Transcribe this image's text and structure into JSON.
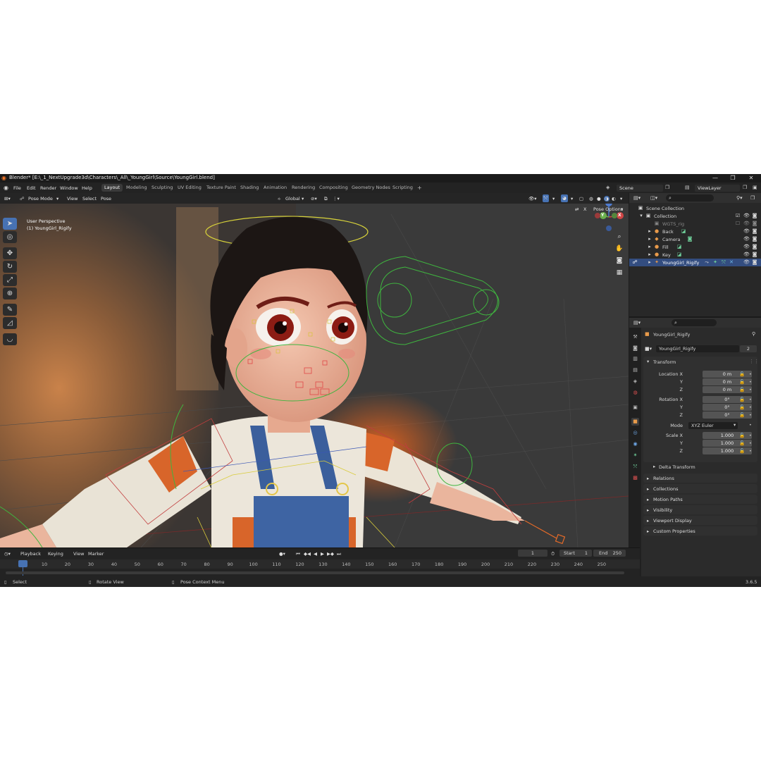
{
  "window": {
    "title": "Blender* [E:\\_1_NextUpgrade3d\\Characters\\_All\\_YoungGirl\\Source\\YoungGirl.blend]",
    "controls": [
      "—",
      "❐",
      "✕"
    ]
  },
  "menubar": {
    "menus": [
      "File",
      "Edit",
      "Render",
      "Window",
      "Help"
    ],
    "workspaces": [
      "Layout",
      "Modeling",
      "Sculpting",
      "UV Editing",
      "Texture Paint",
      "Shading",
      "Animation",
      "Rendering",
      "Compositing",
      "Geometry Nodes",
      "Scripting"
    ],
    "add_workspace": "+",
    "scene": "Scene",
    "view_layer": "ViewLayer"
  },
  "viewport": {
    "mode": "Pose Mode",
    "menus": [
      "View",
      "Select",
      "Pose"
    ],
    "transform_orientation": "Global",
    "pose_options": "Pose Options",
    "overlay_text_1": "User Perspective",
    "overlay_text_2": "(1) YoungGirl_Rigify",
    "gizmo_axes": {
      "z": "Z",
      "y": "Y",
      "x": "X"
    }
  },
  "timeline": {
    "menus": [
      "Playback",
      "Keying",
      "View",
      "Marker"
    ],
    "current_frame": "1",
    "start_label": "Start",
    "start_value": "1",
    "end_label": "End",
    "end_value": "250",
    "ticks": [
      "1",
      "10",
      "20",
      "30",
      "40",
      "50",
      "60",
      "70",
      "80",
      "90",
      "100",
      "110",
      "120",
      "130",
      "140",
      "150",
      "160",
      "170",
      "180",
      "190",
      "200",
      "210",
      "220",
      "230",
      "240",
      "250"
    ]
  },
  "statusbar": {
    "items": [
      "Select",
      "Rotate View",
      "Pose Context Menu"
    ],
    "version": "3.6.5"
  },
  "outliner": {
    "root": "Scene Collection",
    "collection": "Collection",
    "items": [
      "WGTS_rig",
      "Back",
      "Camera",
      "Fill",
      "Key",
      "YoungGirl_Rigify"
    ]
  },
  "properties": {
    "object_name": "YoungGirl_Rigify",
    "data_name": "YoungGirl_Rigify",
    "users": "2",
    "transform_panel": "Transform",
    "location_labels": [
      "Location X",
      "Y",
      "Z"
    ],
    "location_values": [
      "0 m",
      "0 m",
      "0 m"
    ],
    "rotation_labels": [
      "Rotation X",
      "Y",
      "Z"
    ],
    "rotation_values": [
      "0°",
      "0°",
      "0°"
    ],
    "mode_label": "Mode",
    "mode_value": "XYZ Euler",
    "scale_labels": [
      "Scale X",
      "Y",
      "Z"
    ],
    "scale_values": [
      "1.000",
      "1.000",
      "1.000"
    ],
    "delta_transform": "Delta Transform",
    "panels": [
      "Relations",
      "Collections",
      "Motion Paths",
      "Visibility",
      "Viewport Display",
      "Custom Properties"
    ]
  },
  "colors": {
    "accent": "#4772b3",
    "selection": "#334d80",
    "background": "#1d1d1d"
  }
}
